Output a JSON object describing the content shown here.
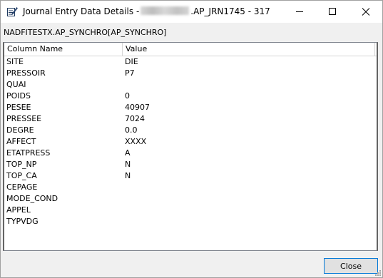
{
  "window": {
    "title_prefix": "Journal Entry Data Details -",
    "title_suffix": ".AP_JRN1745 - 317"
  },
  "subtitle": "NADFITESTX.AP_SYNCHRO[AP_SYNCHRO]",
  "grid": {
    "columns": [
      "Column Name",
      "Value"
    ],
    "rows": [
      {
        "name": "SITE",
        "value": "DIE"
      },
      {
        "name": "PRESSOIR",
        "value": "P7"
      },
      {
        "name": "QUAI",
        "value": ""
      },
      {
        "name": "POIDS",
        "value": "0"
      },
      {
        "name": "PESEE",
        "value": "40907"
      },
      {
        "name": "PRESSEE",
        "value": "7024"
      },
      {
        "name": "DEGRE",
        "value": "0.0"
      },
      {
        "name": "AFFECT",
        "value": "XXXX"
      },
      {
        "name": "ETATPRESS",
        "value": "A"
      },
      {
        "name": "TOP_NP",
        "value": "N"
      },
      {
        "name": "TOP_CA",
        "value": "N"
      },
      {
        "name": "CEPAGE",
        "value": ""
      },
      {
        "name": "MODE_COND",
        "value": ""
      },
      {
        "name": "APPEL",
        "value": ""
      },
      {
        "name": "TYPVDG",
        "value": ""
      }
    ]
  },
  "buttons": {
    "close_label": "Close"
  },
  "icons": {
    "app": "notepad-pencil-icon",
    "minimize": "minimize-icon",
    "maximize": "maximize-icon",
    "close": "close-icon"
  }
}
